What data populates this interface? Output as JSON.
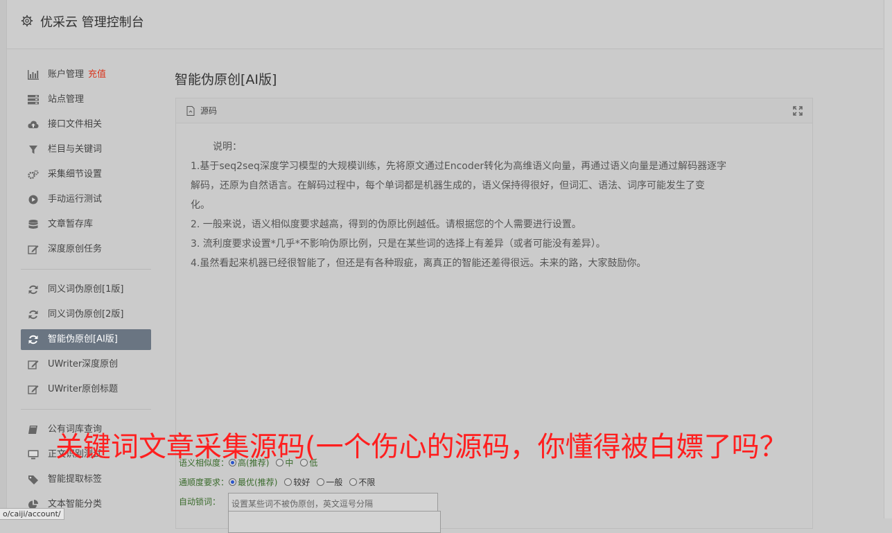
{
  "header": {
    "title": "优采云 管理控制台"
  },
  "sidebar": {
    "group1": [
      {
        "label": "账户管理",
        "extra": "充值",
        "icon": "bar-chart-icon"
      },
      {
        "label": "站点管理",
        "icon": "server-icon"
      },
      {
        "label": "接口文件相关",
        "icon": "cloud-upload-icon"
      },
      {
        "label": "栏目与关键词",
        "icon": "filter-icon"
      },
      {
        "label": "采集细节设置",
        "icon": "cogs-icon"
      },
      {
        "label": "手动运行测试",
        "icon": "play-circle-icon"
      },
      {
        "label": "文章暂存库",
        "icon": "database-icon"
      },
      {
        "label": "深度原创任务",
        "icon": "edit-icon"
      }
    ],
    "group2": [
      {
        "label": "同义词伪原创[1版]",
        "icon": "refresh-icon"
      },
      {
        "label": "同义词伪原创[2版]",
        "icon": "refresh-icon"
      },
      {
        "label": "智能伪原创[AI版]",
        "icon": "refresh-icon"
      },
      {
        "label": "UWriter深度原创",
        "icon": "edit-icon"
      },
      {
        "label": "UWriter原创标题",
        "icon": "edit-icon"
      }
    ],
    "group3": [
      {
        "label": "公有词库查询",
        "icon": "book-icon"
      },
      {
        "label": "正文识别测试",
        "icon": "monitor-icon"
      },
      {
        "label": "智能提取标签",
        "icon": "tag-icon"
      },
      {
        "label": "文本智能分类",
        "icon": "pie-chart-icon"
      }
    ]
  },
  "main": {
    "page_title": "智能伪原创[AI版]",
    "panel_label": "源码",
    "description": {
      "heading": "说明：",
      "line1": "1.基于seq2seq深度学习模型的大规模训练，先将原文通过Encoder转化为高维语义向量，再通过语义向量是通过解码器逐字",
      "line1b": "解码，还原为自然语言。在解码过程中，每个单词都是机器生成的，语义保持得很好，但词汇、语法、词序可能发生了变",
      "line1c": "化。",
      "line2": "2. 一般来说，语义相似度要求越高，得到的伪原比例越低。请根据您的个人需要进行设置。",
      "line3": "3. 流利度要求设置*几乎*不影响伪原比例，只是在某些词的选择上有差异（或者可能没有差异）。",
      "line4": "4.虽然看起来机器已经很智能了，但还是有各种瑕疵，离真正的智能还差得很远。未来的路，大家鼓励你。"
    },
    "form": {
      "similarity_label": "语义相似度：",
      "similarity_options": [
        "高(推荐)",
        "中",
        "低"
      ],
      "fluency_label": "通顺度要求：",
      "fluency_options": [
        "最优(推荐)",
        "较好",
        "一般",
        "不限"
      ],
      "autolock_label": "自动锁词：",
      "autolock_placeholder": "设置某些词不被伪原创，英文逗号分隔"
    }
  },
  "overlay_text": "关键词文章采集源码(一个伤心的源码，你懂得被白嫖了吗？",
  "status_url": "o/caiji/account/"
}
